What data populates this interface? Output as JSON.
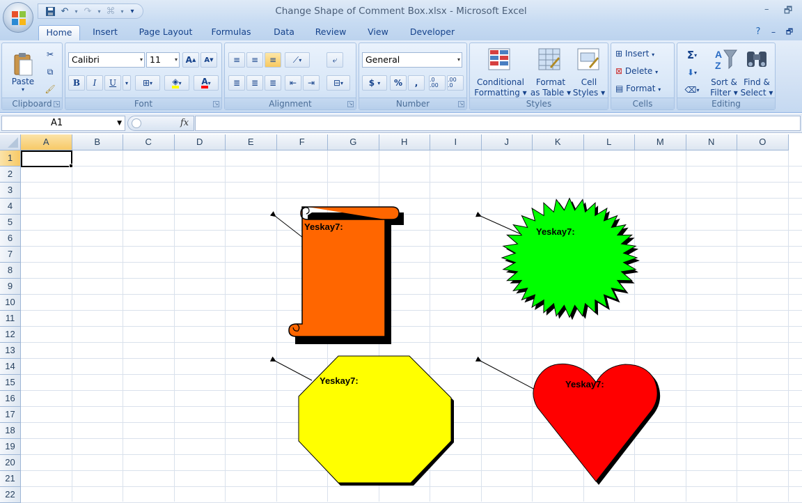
{
  "window": {
    "title": "Change Shape of Comment Box.xlsx - Microsoft Excel",
    "minimize": "–",
    "restore": "🗗"
  },
  "quick_access": {
    "customize": "▾"
  },
  "tabs": [
    {
      "label": "Home",
      "active": true
    },
    {
      "label": "Insert"
    },
    {
      "label": "Page Layout"
    },
    {
      "label": "Formulas"
    },
    {
      "label": "Data"
    },
    {
      "label": "Review"
    },
    {
      "label": "View"
    },
    {
      "label": "Developer"
    }
  ],
  "ribbon": {
    "clipboard": {
      "label": "Clipboard",
      "paste": "Paste"
    },
    "font": {
      "label": "Font",
      "name": "Calibri",
      "size": "11",
      "bold": "B",
      "italic": "I",
      "underline": "U"
    },
    "alignment": {
      "label": "Alignment"
    },
    "number": {
      "label": "Number",
      "format": "General",
      "currency": "$",
      "percent": "%",
      "comma": ",",
      "inc_decimal": ".0 .00",
      "dec_decimal": ".00 .0"
    },
    "styles": {
      "label": "Styles",
      "conditional": "Conditional",
      "conditional2": "Formatting ▾",
      "format_table": "Format",
      "format_table2": "as Table ▾",
      "cell_styles": "Cell",
      "cell_styles2": "Styles ▾"
    },
    "cells": {
      "label": "Cells",
      "insert": "Insert",
      "delete": "Delete",
      "format": "Format"
    },
    "editing": {
      "label": "Editing",
      "sort": "Sort &",
      "sort2": "Filter ▾",
      "find": "Find &",
      "find2": "Select ▾"
    }
  },
  "formula_bar": {
    "name_box": "A1",
    "fx": "fx",
    "value": ""
  },
  "columns": [
    "A",
    "B",
    "C",
    "D",
    "E",
    "F",
    "G",
    "H",
    "I",
    "J",
    "K",
    "L",
    "M",
    "N",
    "O"
  ],
  "rows": [
    "1",
    "2",
    "3",
    "4",
    "5",
    "6",
    "7",
    "8",
    "9",
    "10",
    "11",
    "12",
    "13",
    "14",
    "15",
    "16",
    "17",
    "18",
    "19",
    "20",
    "21",
    "22"
  ],
  "selected_cell": "A1",
  "comments": [
    {
      "shape": "scroll",
      "author": "Yeskay7:",
      "fill": "#ff6600"
    },
    {
      "shape": "starburst",
      "author": "Yeskay7:",
      "fill": "#00ff00"
    },
    {
      "shape": "octagon",
      "author": "Yeskay7:",
      "fill": "#ffff00"
    },
    {
      "shape": "heart",
      "author": "Yeskay7:",
      "fill": "#ff0000"
    }
  ]
}
